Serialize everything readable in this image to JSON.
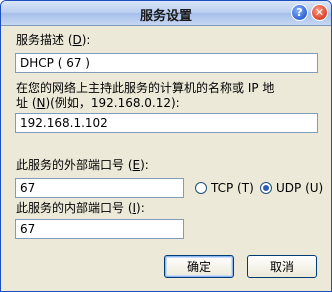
{
  "window": {
    "title": "服务设置"
  },
  "form": {
    "description_label_prefix": "服务描述 (",
    "description_label_key": "D",
    "description_label_suffix": "):",
    "description_value": "DHCP ( 67 )",
    "host_label_line1": "在您的网络上主持此服务的计算机的名称或 IP 地",
    "host_label_line2_prefix": "址 (",
    "host_label_line2_key": "N",
    "host_label_line2_suffix": ")(例如，192.168.0.12):",
    "host_value": "192.168.1.102",
    "external_port_label_prefix": "此服务的外部端口号 (",
    "external_port_label_key": "E",
    "external_port_label_suffix": "):",
    "external_port_value": "67",
    "internal_port_label_prefix": "此服务的内部端口号 (",
    "internal_port_label_key": "I",
    "internal_port_label_suffix": "):",
    "internal_port_value": "67"
  },
  "protocol": {
    "tcp_label": "TCP (T)",
    "udp_label": "UDP (U)",
    "selected": "UDP"
  },
  "buttons": {
    "ok_label": "确定",
    "cancel_label": "取消"
  },
  "icons": {
    "help": "help-icon",
    "close": "close-icon"
  }
}
